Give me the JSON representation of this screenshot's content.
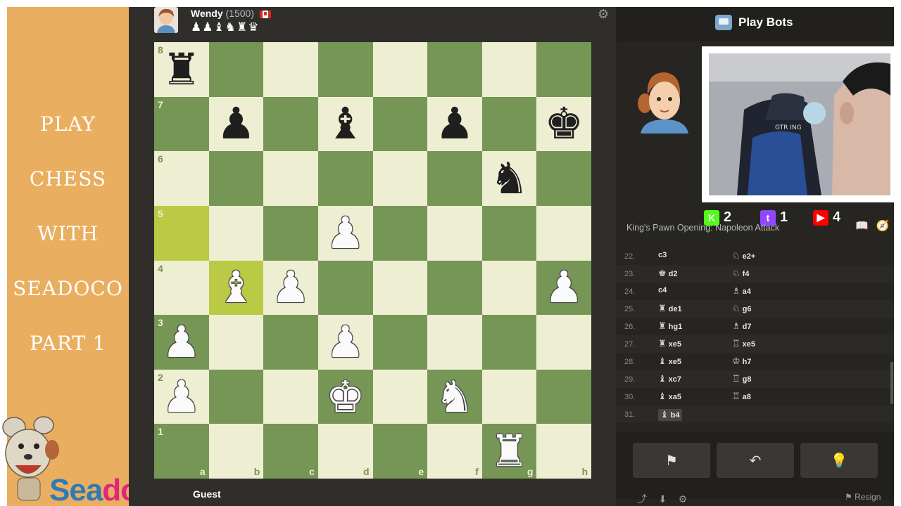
{
  "left_panel": {
    "lines": [
      "PLAY",
      "CHESS",
      "WITH",
      "SEADOCO",
      "PART 1"
    ],
    "brand": [
      "Sea",
      "doco"
    ],
    "brand_colors": [
      "#2d7ab7",
      "#e0277c"
    ]
  },
  "top_player": {
    "name": "Wendy",
    "rating": "(1500)",
    "captured": "♟♟♝♞♜♛"
  },
  "bottom_player": {
    "name": "Guest"
  },
  "board": {
    "ranks": [
      "8",
      "7",
      "6",
      "5",
      "4",
      "3",
      "2",
      "1"
    ],
    "files": [
      "a",
      "b",
      "c",
      "d",
      "e",
      "f",
      "g",
      "h"
    ],
    "position": [
      [
        "bR",
        "",
        "",
        "",
        "",
        "",
        "",
        ""
      ],
      [
        "",
        "bP",
        "",
        "bB",
        "",
        "bP",
        "",
        "bK"
      ],
      [
        "",
        "",
        "",
        "",
        "",
        "",
        "bN",
        ""
      ],
      [
        "",
        "",
        "",
        "wP",
        "",
        "",
        "",
        ""
      ],
      [
        "",
        "wB",
        "wP",
        "",
        "",
        "",
        "",
        "wP"
      ],
      [
        "wP",
        "",
        "",
        "wP",
        "",
        "",
        "",
        ""
      ],
      [
        "wP",
        "",
        "",
        "wK",
        "",
        "wN",
        "",
        ""
      ],
      [
        "",
        "",
        "",
        "",
        "",
        "",
        "wR",
        ""
      ]
    ],
    "highlighted": [
      "a5",
      "b4"
    ],
    "light_color": "#eeeed2",
    "dark_color": "#769656"
  },
  "right_panel": {
    "title": "Play Bots",
    "opening": "King's Pawn Opening: Napoleon Attack",
    "social": [
      {
        "icon": "kick-icon",
        "label": "K",
        "count": "2",
        "color": "#53fc18"
      },
      {
        "icon": "twitch-icon",
        "label": "t",
        "count": "1",
        "color": "#9146ff"
      },
      {
        "icon": "youtube-icon",
        "label": "▶",
        "count": "4",
        "color": "#ff0000"
      }
    ],
    "moves": [
      {
        "num": "22.",
        "white_glyph": "",
        "white": "c3",
        "black_glyph": "♘",
        "black": "e2+"
      },
      {
        "num": "23.",
        "white_glyph": "♚",
        "white": "d2",
        "black_glyph": "♘",
        "black": "f4"
      },
      {
        "num": "24.",
        "white_glyph": "",
        "white": "c4",
        "black_glyph": "♗",
        "black": "a4"
      },
      {
        "num": "25.",
        "white_glyph": "♜",
        "white": "de1",
        "black_glyph": "♘",
        "black": "g6"
      },
      {
        "num": "26.",
        "white_glyph": "♜",
        "white": "hg1",
        "black_glyph": "♗",
        "black": "d7"
      },
      {
        "num": "27.",
        "white_glyph": "♜",
        "white": "xe5",
        "black_glyph": "♖",
        "black": "xe5"
      },
      {
        "num": "28.",
        "white_glyph": "♝",
        "white": "xe5",
        "black_glyph": "♔",
        "black": "h7"
      },
      {
        "num": "29.",
        "white_glyph": "♝",
        "white": "xc7",
        "black_glyph": "♖",
        "black": "g8"
      },
      {
        "num": "30.",
        "white_glyph": "♝",
        "white": "xa5",
        "black_glyph": "♖",
        "black": "a8"
      },
      {
        "num": "31.",
        "white_glyph": "♝",
        "white": "b4",
        "black_glyph": "",
        "black": ""
      }
    ],
    "buttons": {
      "flag": "⚑",
      "back": "↶",
      "hint": "💡"
    },
    "resign_label": "Resign"
  }
}
